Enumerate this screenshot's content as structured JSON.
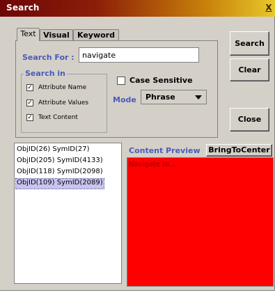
{
  "window": {
    "title": "Search",
    "close_label": "X"
  },
  "tabs": [
    {
      "label": "Text",
      "active": true
    },
    {
      "label": "Visual",
      "active": false
    },
    {
      "label": "Keyword",
      "active": false
    }
  ],
  "search": {
    "label": "Search For :",
    "value": "navigate",
    "placeholder": ""
  },
  "search_in": {
    "title": "Search in",
    "options": [
      {
        "label": "Attribute Name",
        "checked": true
      },
      {
        "label": "Attribute Values",
        "checked": true
      },
      {
        "label": "Text Content",
        "checked": true
      }
    ]
  },
  "case_sensitive": {
    "label": "Case Sensitive",
    "checked": false
  },
  "mode": {
    "label": "Mode",
    "selected": "Phrase"
  },
  "buttons": {
    "search": "Search",
    "clear": "Clear",
    "close": "Close",
    "bring_to_center": "BringToCenter"
  },
  "results": [
    {
      "text": "ObjID(26) SymID(27)",
      "selected": false
    },
    {
      "text": "ObjID(205) SymID(4133)",
      "selected": false
    },
    {
      "text": "ObjID(118) SymID(2098)",
      "selected": false
    },
    {
      "text": "ObjID(109) SymID(2089)",
      "selected": true
    }
  ],
  "preview": {
    "label": "Content Preview",
    "text": "Navigate to...",
    "background": "#ff0000"
  },
  "colors": {
    "accent_label": "#4a5ab8",
    "selection": "#c8c4f0"
  }
}
